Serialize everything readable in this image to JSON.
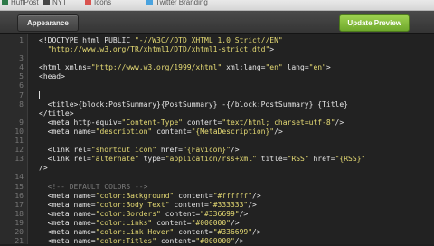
{
  "bookmarks": [
    {
      "label": "HuffPost",
      "icon": "huffpost-icon",
      "color": "#2e7a49"
    },
    {
      "label": "NYT",
      "icon": "nyt-icon",
      "color": "#444444"
    },
    {
      "label": "Icons",
      "icon": "icons-icon",
      "color": "#d9534f"
    },
    {
      "label": "Twitter Branding",
      "icon": "twitter-icon",
      "color": "#4aa3df"
    }
  ],
  "toolbar": {
    "appearance_label": "Appearance",
    "update_label": "Update Preview"
  },
  "editor": {
    "lines": [
      {
        "n": "1",
        "parts": [
          [
            "t-tag",
            "<!DOCTYPE html PUBLIC "
          ],
          [
            "t-str",
            "\"-//W3C//DTD XHTML 1.0 Strict//EN\""
          ]
        ]
      },
      {
        "n": "",
        "parts": [
          [
            "t-str",
            "  \"http://www.w3.org/TR/xhtml1/DTD/xhtml1-strict.dtd\""
          ],
          [
            "t-tag",
            ">"
          ]
        ]
      },
      {
        "n": "3",
        "parts": []
      },
      {
        "n": "4",
        "parts": [
          [
            "t-tag",
            "<html xmlns="
          ],
          [
            "t-str",
            "\"http://www.w3.org/1999/xhtml\""
          ],
          [
            "t-tag",
            " xml:lang="
          ],
          [
            "t-str",
            "\"en\""
          ],
          [
            "t-tag",
            " lang="
          ],
          [
            "t-str",
            "\"en\""
          ],
          [
            "t-tag",
            ">"
          ]
        ]
      },
      {
        "n": "5",
        "parts": [
          [
            "t-tag",
            "<head>"
          ]
        ]
      },
      {
        "n": "6",
        "parts": []
      },
      {
        "n": "7",
        "parts": [
          [
            "cursor",
            ""
          ]
        ]
      },
      {
        "n": "8",
        "parts": [
          [
            "t-tag",
            "  <title>{block:PostSummary}{PostSummary} -{/block:PostSummary} {Title}"
          ]
        ]
      },
      {
        "n": "",
        "parts": [
          [
            "t-tag",
            "</title>"
          ]
        ]
      },
      {
        "n": "9",
        "parts": [
          [
            "t-tag",
            "  <meta http-equiv="
          ],
          [
            "t-str",
            "\"Content-Type\""
          ],
          [
            "t-tag",
            " content="
          ],
          [
            "t-str",
            "\"text/html; charset=utf-8\""
          ],
          [
            "t-tag",
            "/>"
          ]
        ]
      },
      {
        "n": "10",
        "parts": [
          [
            "t-tag",
            "  <meta name="
          ],
          [
            "t-str",
            "\"description\""
          ],
          [
            "t-tag",
            " content="
          ],
          [
            "t-str",
            "\"{MetaDescription}\""
          ],
          [
            "t-tag",
            "/>"
          ]
        ]
      },
      {
        "n": "11",
        "parts": []
      },
      {
        "n": "12",
        "parts": [
          [
            "t-tag",
            "  <link rel="
          ],
          [
            "t-str",
            "\"shortcut icon\""
          ],
          [
            "t-tag",
            " href="
          ],
          [
            "t-str",
            "\"{Favicon}\""
          ],
          [
            "t-tag",
            "/>"
          ]
        ]
      },
      {
        "n": "13",
        "parts": [
          [
            "t-tag",
            "  <link rel="
          ],
          [
            "t-str",
            "\"alternate\""
          ],
          [
            "t-tag",
            " type="
          ],
          [
            "t-str",
            "\"application/rss+xml\""
          ],
          [
            "t-tag",
            " title="
          ],
          [
            "t-str",
            "\"RSS\""
          ],
          [
            "t-tag",
            " href="
          ],
          [
            "t-str",
            "\"{RSS}\""
          ]
        ]
      },
      {
        "n": "",
        "parts": [
          [
            "t-tag",
            "/>"
          ]
        ]
      },
      {
        "n": "14",
        "parts": []
      },
      {
        "n": "15",
        "parts": [
          [
            "t-com",
            "  <!-- DEFAULT COLORS -->"
          ]
        ]
      },
      {
        "n": "16",
        "parts": [
          [
            "t-tag",
            "  <meta name="
          ],
          [
            "t-str",
            "\"color:Background\""
          ],
          [
            "t-tag",
            " content="
          ],
          [
            "t-str",
            "\"#ffffff\""
          ],
          [
            "t-tag",
            "/>"
          ]
        ]
      },
      {
        "n": "17",
        "parts": [
          [
            "t-tag",
            "  <meta name="
          ],
          [
            "t-str",
            "\"color:Body Text\""
          ],
          [
            "t-tag",
            " content="
          ],
          [
            "t-str",
            "\"#333333\""
          ],
          [
            "t-tag",
            "/>"
          ]
        ]
      },
      {
        "n": "18",
        "parts": [
          [
            "t-tag",
            "  <meta name="
          ],
          [
            "t-str",
            "\"color:Borders\""
          ],
          [
            "t-tag",
            " content="
          ],
          [
            "t-str",
            "\"#336699\""
          ],
          [
            "t-tag",
            "/>"
          ]
        ]
      },
      {
        "n": "19",
        "parts": [
          [
            "t-tag",
            "  <meta name="
          ],
          [
            "t-str",
            "\"color:Links\""
          ],
          [
            "t-tag",
            " content="
          ],
          [
            "t-str",
            "\"#000000\""
          ],
          [
            "t-tag",
            "/>"
          ]
        ]
      },
      {
        "n": "20",
        "parts": [
          [
            "t-tag",
            "  <meta name="
          ],
          [
            "t-str",
            "\"color:Link Hover\""
          ],
          [
            "t-tag",
            " content="
          ],
          [
            "t-str",
            "\"#336699\""
          ],
          [
            "t-tag",
            "/>"
          ]
        ]
      },
      {
        "n": "21",
        "parts": [
          [
            "t-tag",
            "  <meta name="
          ],
          [
            "t-str",
            "\"color:Titles\""
          ],
          [
            "t-tag",
            " content="
          ],
          [
            "t-str",
            "\"#000000\""
          ],
          [
            "t-tag",
            "/>"
          ]
        ]
      }
    ]
  }
}
